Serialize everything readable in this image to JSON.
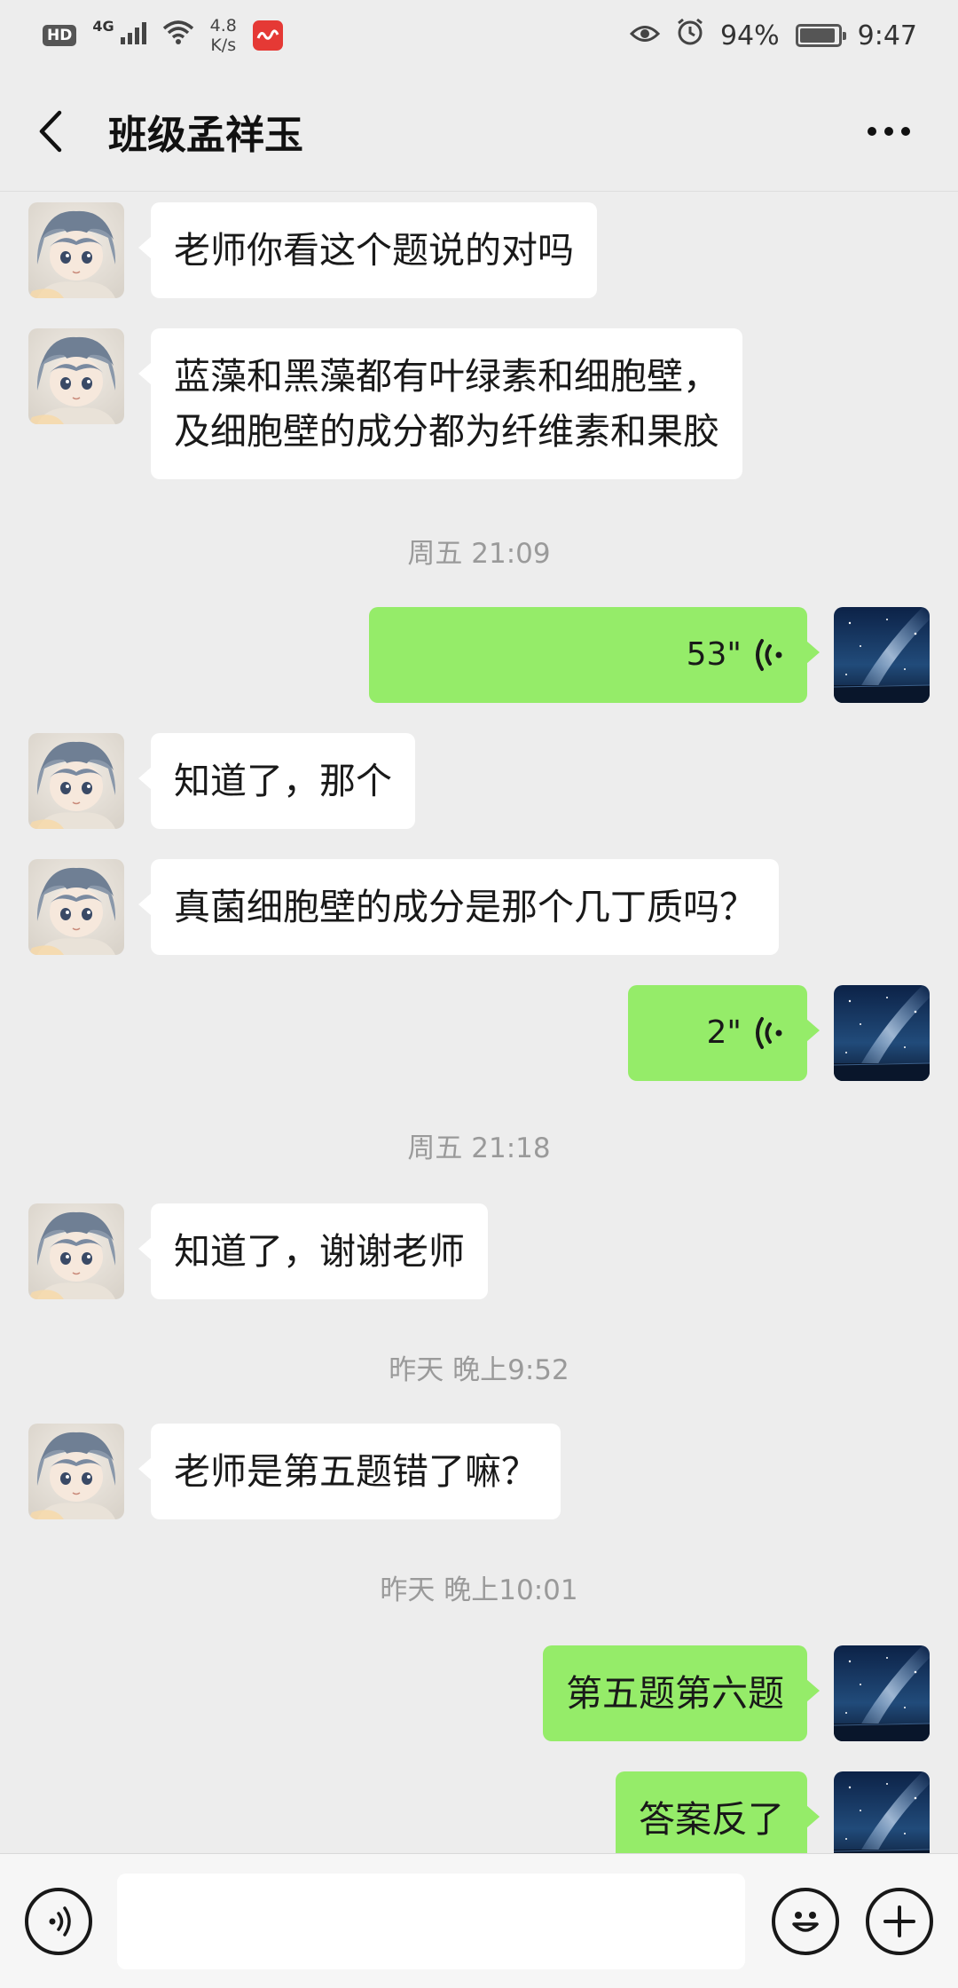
{
  "status_bar": {
    "hd": "HD",
    "network_type": "4G",
    "speed_value": "4.8",
    "speed_unit": "K/s",
    "battery": "94%",
    "battery_level": 0.94,
    "time": "9:47",
    "icons": [
      "signal-icon",
      "wifi-icon",
      "app-notification-icon",
      "eye-icon",
      "alarm-icon",
      "battery-icon"
    ]
  },
  "header": {
    "title": "班级孟祥玉",
    "back_icon": "chevron-left-icon",
    "more_icon": "more-dots-icon"
  },
  "messages": [
    {
      "side": "recv",
      "text": "老师你看这个题说的对吗"
    },
    {
      "side": "recv",
      "lines": [
        "蓝藻和黑藻都有叶绿素和细胞壁，",
        "及细胞壁的成分都为纤维素和果胶"
      ]
    },
    {
      "type": "timestamp",
      "text": "周五 21:09"
    },
    {
      "side": "sent",
      "type": "voice",
      "duration": "53\""
    },
    {
      "side": "recv",
      "text": "知道了，那个"
    },
    {
      "side": "recv",
      "text": "真菌细胞壁的成分是那个几丁质吗？"
    },
    {
      "side": "sent",
      "type": "voice",
      "duration": "2\""
    },
    {
      "type": "timestamp",
      "text": "周五 21:18"
    },
    {
      "side": "recv",
      "text": "知道了，谢谢老师"
    },
    {
      "type": "timestamp",
      "text": "昨天 晚上9:52"
    },
    {
      "side": "recv",
      "text": "老师是第五题错了嘛？"
    },
    {
      "type": "timestamp",
      "text": "昨天 晚上10:01"
    },
    {
      "side": "sent",
      "text": "第五题第六题"
    },
    {
      "side": "sent",
      "text": "答案反了"
    }
  ],
  "input_bar": {
    "voice_icon": "voice-input-icon",
    "text_value": "",
    "emoji_icon": "emoji-icon",
    "plus_icon": "plus-icon"
  },
  "colors": {
    "background": "#ededed",
    "sent_bubble": "#95ec69",
    "recv_bubble": "#ffffff",
    "timestamp": "#9a9a9a"
  }
}
